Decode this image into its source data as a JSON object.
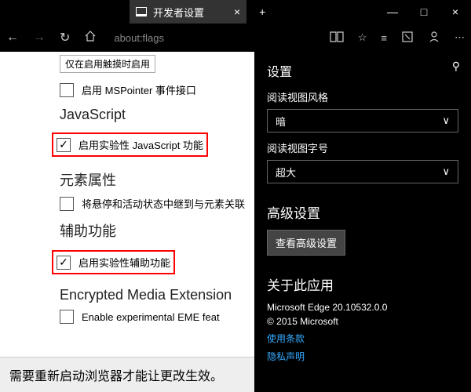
{
  "tab": {
    "title": "开发者设置"
  },
  "addr": "about:flags",
  "main": {
    "topBox": "仅在启用触摸时启用",
    "cb1": "启用 MSPointer 事件接口",
    "s1": "JavaScript",
    "cb2": "启用实验性 JavaScript 功能",
    "s2": "元素属性",
    "cb3": "将悬停和活动状态中继到与元素关联",
    "s3": "辅助功能",
    "cb4": "启用实验性辅助功能",
    "s4": "Encrypted Media Extension",
    "cb5": "Enable experimental EME feat",
    "banner": "需要重新启动浏览器才能让更改生效。"
  },
  "side": {
    "title": "设置",
    "l1": "阅读视图风格",
    "v1": "暗",
    "l2": "阅读视图字号",
    "v2": "超大",
    "h1": "高级设置",
    "btn": "查看高级设置",
    "h2": "关于此应用",
    "ver": "Microsoft Edge 20.10532.0.0",
    "cop": "© 2015 Microsoft",
    "lk1": "使用条款",
    "lk2": "隐私声明"
  }
}
